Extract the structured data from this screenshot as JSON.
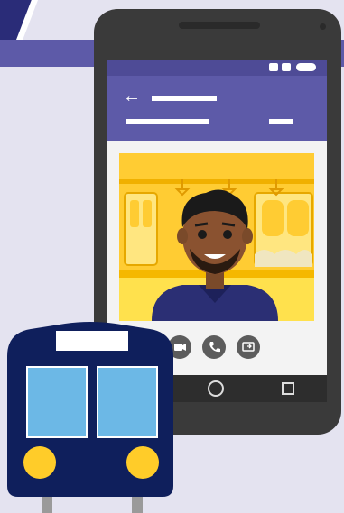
{
  "colors": {
    "background": "#e4e3f0",
    "brand_purple": "#5d5aa8",
    "brand_purple_dark": "#4e4b96",
    "phone_body": "#3a3a3a",
    "video_background": "#ffcc33",
    "train_body": "#0f1f5c",
    "train_window": "#6cb8e6",
    "train_light": "#ffcc29"
  },
  "illustration": {
    "subjects": [
      "smartphone-video-call",
      "person-on-train",
      "train-front-icon"
    ]
  },
  "phone": {
    "header_icons": [
      "back-arrow-icon"
    ],
    "call_controls": [
      "camera-icon",
      "phone-icon",
      "screen-share-icon"
    ],
    "nav_icons": [
      "home-circle-icon",
      "recent-apps-square-icon"
    ]
  }
}
